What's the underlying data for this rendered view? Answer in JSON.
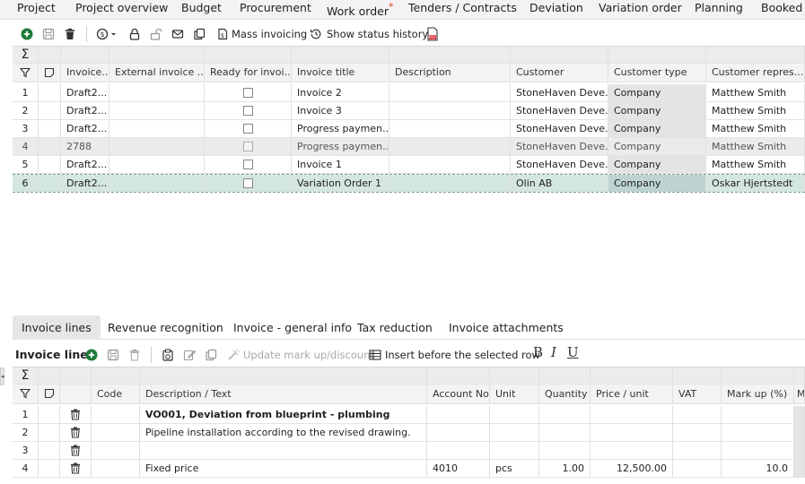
{
  "topnav": {
    "tabs": [
      "Project",
      "Project overview",
      "Budget",
      "Procurement",
      "Work order",
      "Tenders / Contracts",
      "Deviation",
      "Variation order",
      "Planning",
      "Booked C"
    ],
    "work_order_marker": "*"
  },
  "toolbar": {
    "mass_invoicing": "Mass invoicing",
    "show_status_history": "Show status history"
  },
  "invoice_grid": {
    "headers": [
      "Invoice...",
      "External invoice ...",
      "Ready for invoi...",
      "Invoice title",
      "Description",
      "Customer",
      "Customer type",
      "Customer repres..."
    ],
    "rows": [
      {
        "num": "1",
        "invoice": "Draft2...",
        "external": "",
        "ready": false,
        "title": "Invoice 2",
        "description": "",
        "customer": "StoneHaven Deve...",
        "ctype": "Company",
        "rep": "Matthew Smith"
      },
      {
        "num": "2",
        "invoice": "Draft2...",
        "external": "",
        "ready": false,
        "title": "Invoice 3",
        "description": "",
        "customer": "StoneHaven Deve...",
        "ctype": "Company",
        "rep": "Matthew Smith"
      },
      {
        "num": "3",
        "invoice": "Draft2...",
        "external": "",
        "ready": false,
        "title": "Progress paymen...",
        "description": "",
        "customer": "StoneHaven Deve...",
        "ctype": "Company",
        "rep": "Matthew Smith"
      },
      {
        "num": "4",
        "invoice": "2788",
        "external": "",
        "ready": false,
        "title": "Progress paymen...",
        "description": "",
        "customer": "StoneHaven Deve...",
        "ctype": "Company",
        "rep": "Matthew Smith"
      },
      {
        "num": "5",
        "invoice": "Draft2...",
        "external": "",
        "ready": false,
        "title": "Invoice 1",
        "description": "",
        "customer": "StoneHaven Deve...",
        "ctype": "Company",
        "rep": "Matthew Smith"
      },
      {
        "num": "6",
        "invoice": "Draft2...",
        "external": "",
        "ready": false,
        "title": "Variation Order 1",
        "description": "",
        "customer": "Olin AB",
        "ctype": "Company",
        "rep": "Oskar Hjertstedt"
      }
    ]
  },
  "tabs": [
    "Invoice lines",
    "Revenue recognition",
    "Invoice - general info",
    "Tax reduction",
    "Invoice attachments"
  ],
  "lines_toolbar": {
    "title": "Invoice lines",
    "update_markup": "Update mark up/discount",
    "insert_before": "Insert before the selected row",
    "bold": "B",
    "italic": "I",
    "underline": "U"
  },
  "lines_grid": {
    "headers": [
      "Code",
      "Description / Text",
      "Account No",
      "Unit",
      "Quantity",
      "Price / unit",
      "VAT",
      "Mark up (%)",
      "M"
    ],
    "rows": [
      {
        "num": "1",
        "code": "",
        "text": "VO001, Deviation from blueprint - plumbing",
        "bold": true,
        "account": "",
        "unit": "",
        "qty": "",
        "price": "",
        "vat": "",
        "markup": ""
      },
      {
        "num": "2",
        "code": "",
        "text": "Pipeline installation according to the revised drawing.",
        "bold": false,
        "account": "",
        "unit": "",
        "qty": "",
        "price": "",
        "vat": "",
        "markup": ""
      },
      {
        "num": "3",
        "code": "",
        "text": "",
        "bold": false,
        "account": "",
        "unit": "",
        "qty": "",
        "price": "",
        "vat": "",
        "markup": ""
      },
      {
        "num": "4",
        "code": "",
        "text": "Fixed price",
        "bold": false,
        "account": "4010",
        "unit": "pcs",
        "qty": "1.00",
        "price": "12,500.00",
        "vat": "",
        "markup": "10.0"
      }
    ]
  },
  "colors": {
    "accent_green": "#1f7a3a",
    "selected_row": "#d4e6e2",
    "pdf_red": "#d9272e"
  }
}
